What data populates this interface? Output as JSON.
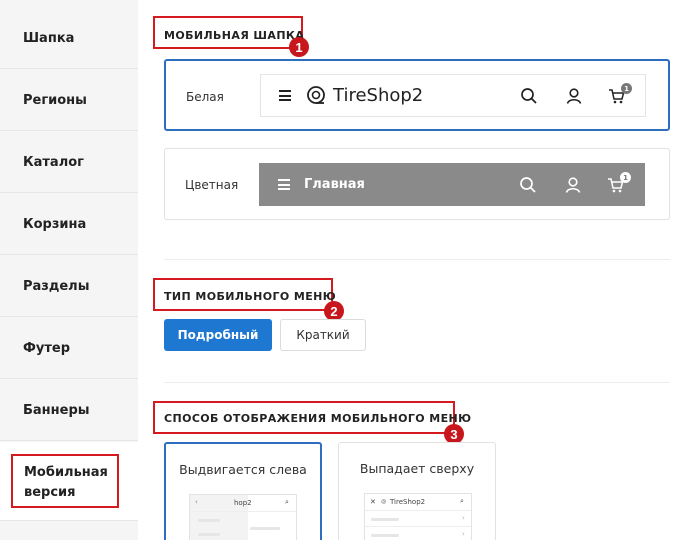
{
  "sidebar": {
    "items": [
      {
        "label": "Шапка"
      },
      {
        "label": "Регионы"
      },
      {
        "label": "Каталог"
      },
      {
        "label": "Корзина"
      },
      {
        "label": "Разделы"
      },
      {
        "label": "Футер"
      },
      {
        "label": "Баннеры"
      },
      {
        "label": "Мобильная версия"
      }
    ]
  },
  "sections": {
    "mobile_header": {
      "title": "МОБИЛЬНАЯ ШАПКА",
      "badge": "1",
      "options": [
        {
          "label": "Белая",
          "logo_text": "TireShop2",
          "cart_count": "1",
          "selected": true
        },
        {
          "label": "Цветная",
          "nav_text": "Главная",
          "cart_count": "1",
          "selected": false
        }
      ]
    },
    "menu_type": {
      "title": "ТИП МОБИЛЬНОГО МЕНЮ",
      "badge": "2",
      "options": [
        {
          "label": "Подробный",
          "selected": true
        },
        {
          "label": "Краткий",
          "selected": false
        }
      ]
    },
    "display_mode": {
      "title": "СПОСОБ ОТОБРАЖЕНИЯ МОБИЛЬНОГО МЕНЮ",
      "badge": "3",
      "options": [
        {
          "label": "Выдвигается слева",
          "mini_text": "hop2",
          "selected": true
        },
        {
          "label": "Выпадает сверху",
          "mini_text": "TireShop2",
          "selected": false
        }
      ]
    }
  },
  "colors": {
    "accent": "#1e78d2",
    "selected_border": "#2d6fbf",
    "annotation_red": "#d41a1f",
    "colored_header": "#8a8a8a"
  }
}
